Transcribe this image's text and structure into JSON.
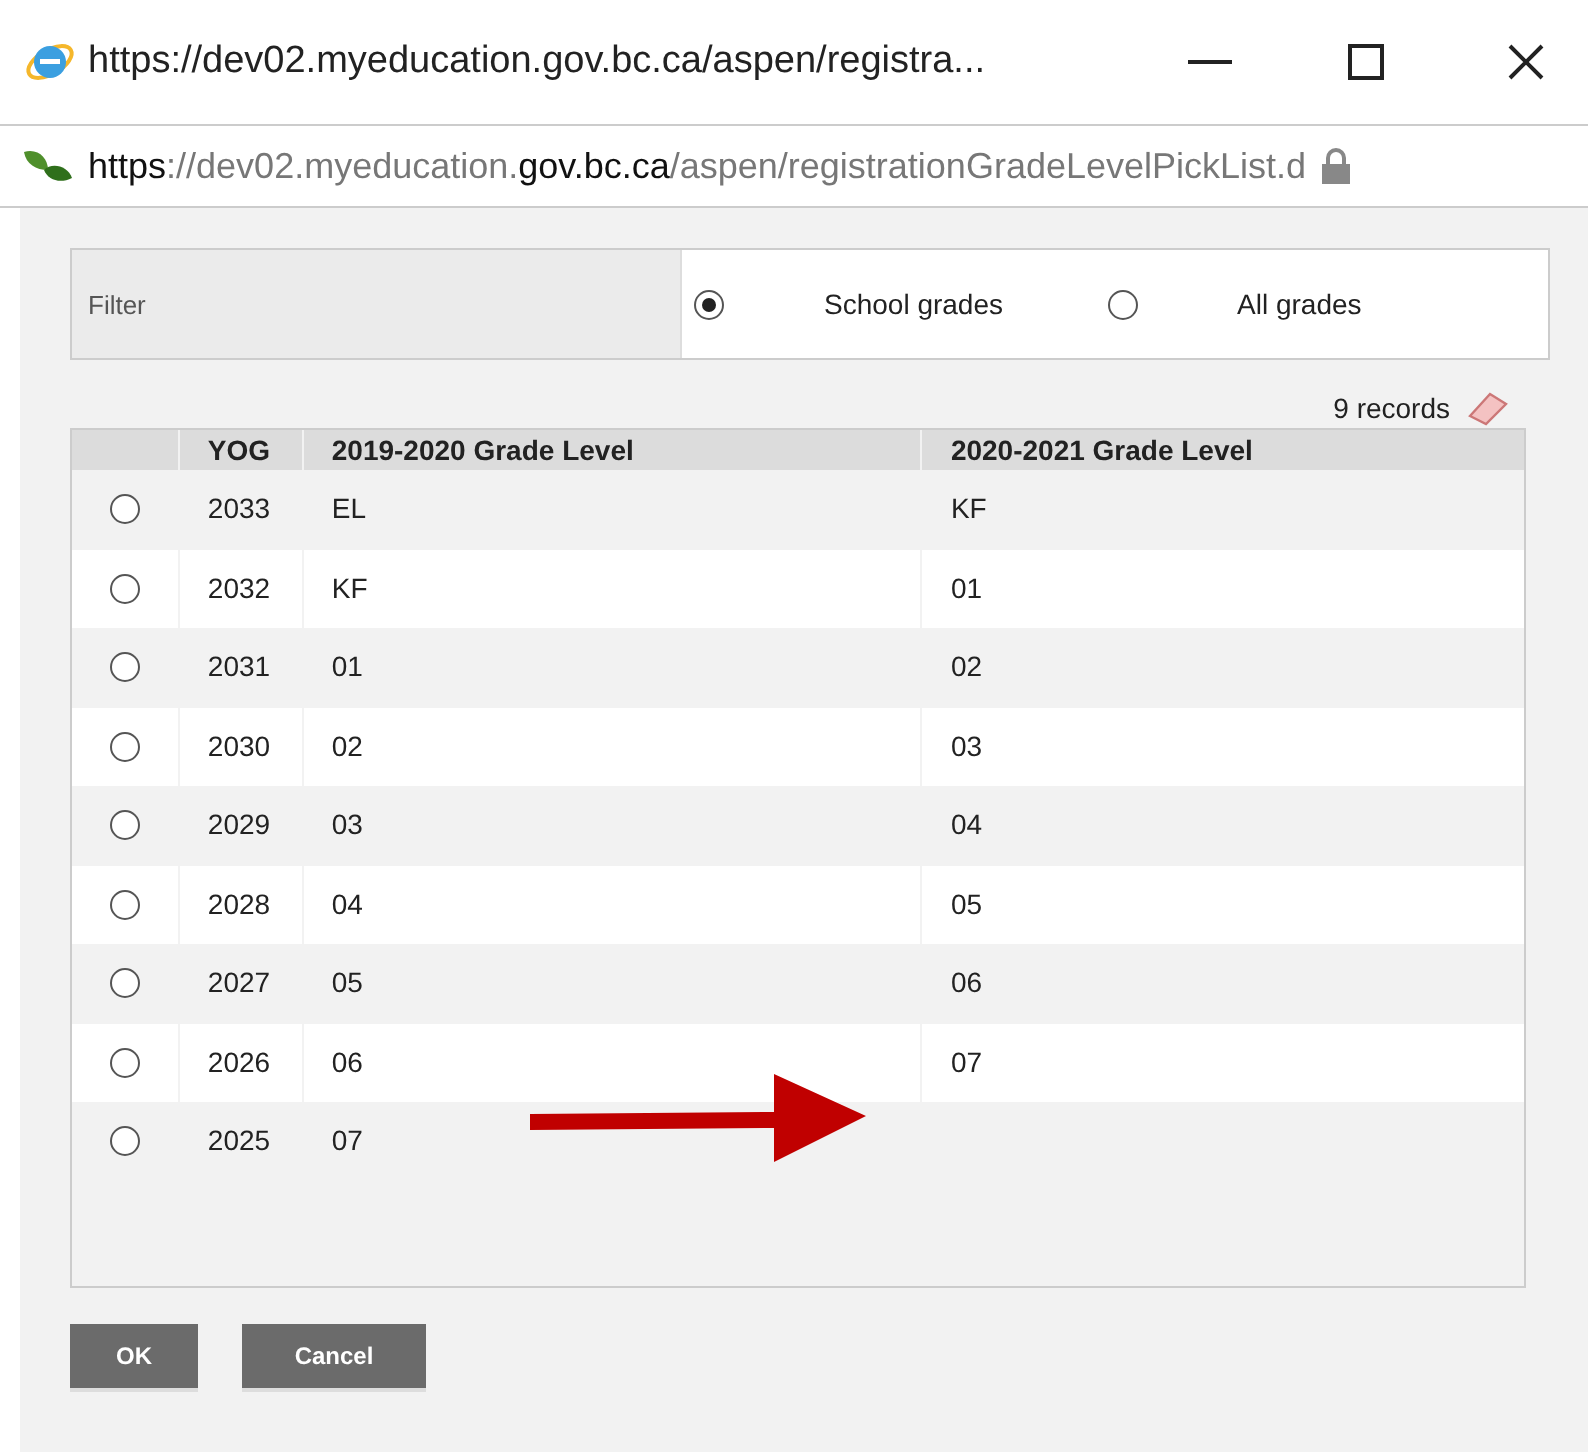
{
  "window": {
    "title": "https://dev02.myeducation.gov.bc.ca/aspen/registra..."
  },
  "address_bar": {
    "scheme": "https",
    "url_host_prefix": "://dev02.myeducation.",
    "url_domain": "gov.bc.ca",
    "url_path": "/aspen/registrationGradeLevelPickList.d"
  },
  "filter": {
    "label": "Filter",
    "options": [
      {
        "label": "School grades",
        "selected": true
      },
      {
        "label": "All grades",
        "selected": false
      }
    ]
  },
  "record_count": "9 records",
  "table": {
    "columns": [
      "YOG",
      "2019-2020 Grade Level",
      "2020-2021 Grade Level"
    ],
    "rows": [
      {
        "selected": false,
        "yog": "2033",
        "grade_2019": "EL",
        "grade_2020": "KF"
      },
      {
        "selected": false,
        "yog": "2032",
        "grade_2019": "KF",
        "grade_2020": "01"
      },
      {
        "selected": false,
        "yog": "2031",
        "grade_2019": "01",
        "grade_2020": "02"
      },
      {
        "selected": false,
        "yog": "2030",
        "grade_2019": "02",
        "grade_2020": "03"
      },
      {
        "selected": false,
        "yog": "2029",
        "grade_2019": "03",
        "grade_2020": "04"
      },
      {
        "selected": false,
        "yog": "2028",
        "grade_2019": "04",
        "grade_2020": "05"
      },
      {
        "selected": false,
        "yog": "2027",
        "grade_2019": "05",
        "grade_2020": "06"
      },
      {
        "selected": false,
        "yog": "2026",
        "grade_2019": "06",
        "grade_2020": "07"
      },
      {
        "selected": false,
        "yog": "2025",
        "grade_2019": "07"
      }
    ]
  },
  "buttons": [
    "OK",
    "Cancel"
  ]
}
